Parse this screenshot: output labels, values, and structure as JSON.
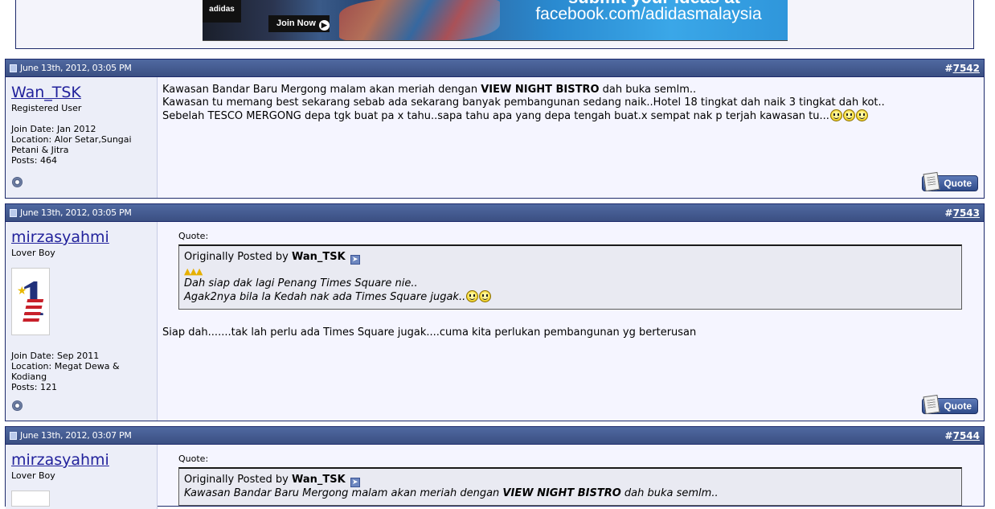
{
  "banner": {
    "logo": "adidas",
    "join_label": "Join Now",
    "tagline_top": "submit your ideas at",
    "tagline": "facebook.com/adidasmalaysia"
  },
  "posts": [
    {
      "date": "June 13th, 2012, 03:05 PM",
      "number_prefix": "#",
      "number": "7542",
      "username": "Wan_TSK",
      "user_title": "Registered User",
      "join_date": "Join Date: Jan 2012",
      "location": "Location: Alor Setar,Sungai Petani & Jitra",
      "posts": "Posts: 464",
      "message": {
        "line1_pre": "Kawasan Bandar Baru Mergong malam akan meriah dengan ",
        "line1_bold": "VIEW NIGHT BISTRO",
        "line1_post": " dah buka semlm..",
        "line2": "Kawasan tu memang best sekarang sebab ada sekarang banyak pembangunan sedang naik..Hotel 18 tingkat dah naik 3 tingkat dah kot..",
        "line3": "Sebelah TESCO MERGONG depa tgk buat pa x tahu..sapa tahu apa yang depa tengah buat.x sempat nak p terjah kawasan tu..."
      },
      "quote_button": "Quote"
    },
    {
      "date": "June 13th, 2012, 03:05 PM",
      "number_prefix": "#",
      "number": "7543",
      "username": "mirzasyahmi",
      "user_title": "Lover Boy",
      "join_date": "Join Date: Sep 2011",
      "location": "Location: Megat Dewa & Kodiang",
      "posts": "Posts: 121",
      "quote": {
        "label": "Quote:",
        "originally": "Originally Posted by ",
        "author": "Wan_TSK",
        "line1": "Dah siap dak lagi Penang Times Square nie..",
        "line2": "Agak2nya bila la Kedah nak ada Times Square jugak.."
      },
      "message": "Siap dah.......tak lah perlu ada Times Square jugak....cuma kita perlukan pembangunan yg berterusan",
      "quote_button": "Quote"
    },
    {
      "date": "June 13th, 2012, 03:07 PM",
      "number_prefix": "#",
      "number": "7544",
      "username": "mirzasyahmi",
      "user_title": "Lover Boy",
      "quote": {
        "label": "Quote:",
        "originally": "Originally Posted by ",
        "author": "Wan_TSK",
        "line1_pre": "Kawasan Bandar Baru Mergong malam akan meriah dengan ",
        "line1_bold": "VIEW NIGHT BISTRO",
        "line1_post": " dah buka semlm.."
      }
    }
  ]
}
